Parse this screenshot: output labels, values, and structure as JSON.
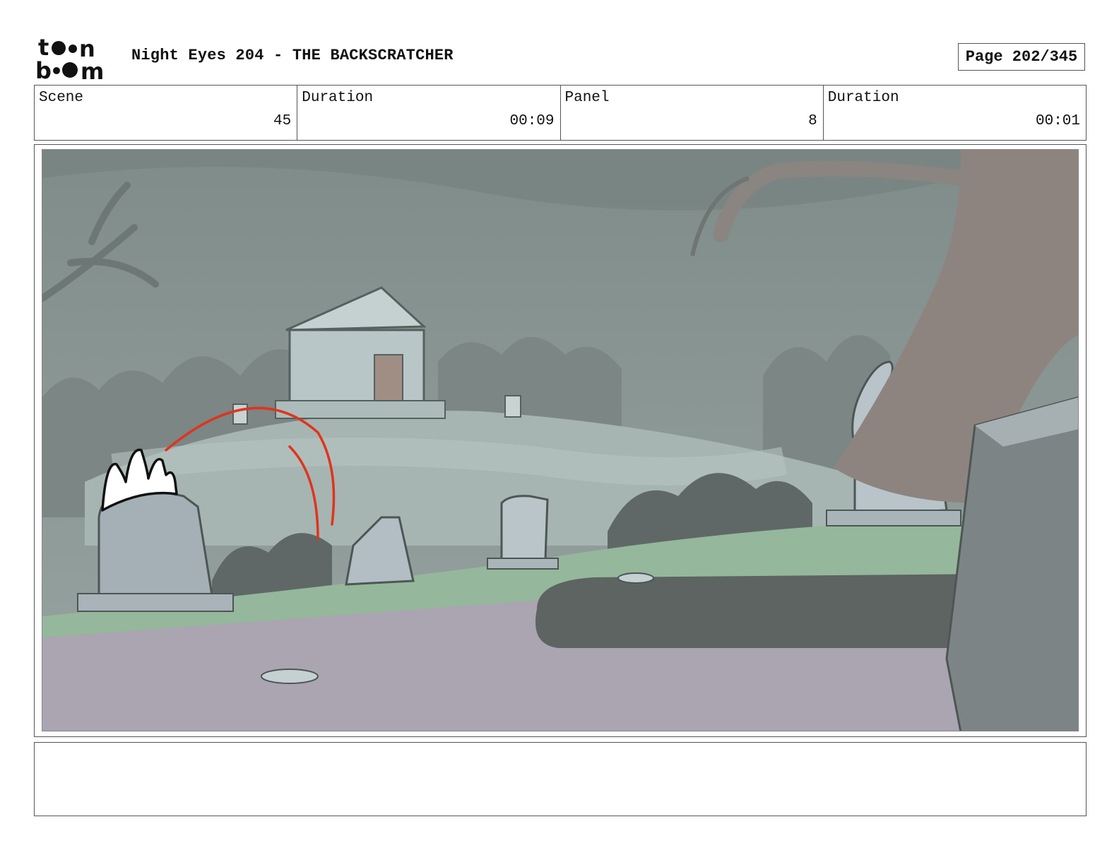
{
  "header": {
    "logo_alt": "toon boom",
    "title": "Night Eyes 204 - THE BACKSCRATCHER",
    "page_label": "Page 202/345"
  },
  "info": {
    "scene_label": "Scene",
    "scene_value": "45",
    "scene_duration_label": "Duration",
    "scene_duration_value": "00:09",
    "panel_label": "Panel",
    "panel_value": "8",
    "panel_duration_label": "Duration",
    "panel_duration_value": "00:01"
  },
  "panel": {
    "image_icon": "storyboard-panel-graveyard",
    "accent_color": "#e0341c"
  },
  "notes": {
    "text": ""
  }
}
